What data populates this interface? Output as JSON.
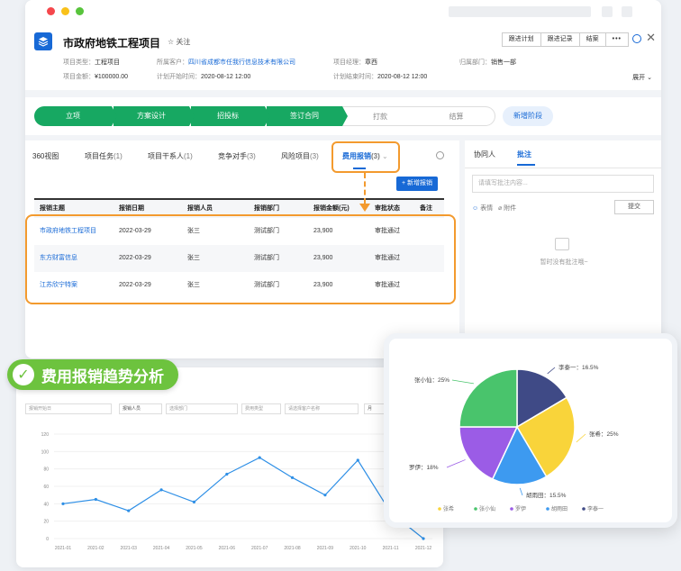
{
  "header": {
    "title": "市政府地铁工程项目",
    "follow": "关注",
    "actions": [
      "跟进计划",
      "跟进记录",
      "结案",
      "•••"
    ],
    "meta": [
      {
        "label": "项目类型：",
        "value": "工程项目"
      },
      {
        "label": "所属客户：",
        "value": "四川省成都市任我行信息技术有限公司"
      },
      {
        "label": "项目经理：",
        "value": "章西"
      },
      {
        "label": "归属部门：",
        "value": "销售一部"
      },
      {
        "label": "项目金额：",
        "value": "¥100000.00"
      },
      {
        "label": "计划开始时间：",
        "value": "2020-08-12  12:00"
      },
      {
        "label": "计划结束时间：",
        "value": "2020-08-12  12:00"
      }
    ],
    "expand": "展开"
  },
  "pipeline": {
    "stages": [
      "立项",
      "方案设计",
      "招投标",
      "签订合同",
      "打款",
      "结算"
    ],
    "done_count": 4,
    "new_stage": "新增阶段"
  },
  "tabs": [
    {
      "label": "360视图",
      "count": ""
    },
    {
      "label": "项目任务",
      "count": "(1)"
    },
    {
      "label": "项目干系人",
      "count": "(1)"
    },
    {
      "label": "竞争对手",
      "count": "(3)"
    },
    {
      "label": "风险项目",
      "count": "(3)"
    },
    {
      "label": "费用报销",
      "count": "(3)"
    }
  ],
  "add_button": "新增报销",
  "table": {
    "headers": [
      "报销主题",
      "报销日期",
      "报销人员",
      "报销部门",
      "报销金额(元)",
      "审批状态",
      "备注"
    ],
    "rows": [
      [
        "市政府地铁工程项目",
        "2022-03-29",
        "张三",
        "测试部门",
        "23,900",
        "审批通过",
        ""
      ],
      [
        "东方财富信息",
        "2022-03-29",
        "张三",
        "测试部门",
        "23,900",
        "审批通过",
        ""
      ],
      [
        "江苏欣宁特案",
        "2022-03-29",
        "张三",
        "测试部门",
        "23,900",
        "审批通过",
        ""
      ]
    ]
  },
  "side": {
    "tabs": [
      "协同人",
      "批注"
    ],
    "placeholder": "请填写批注内容...",
    "emoji": "表情",
    "attach": "附件",
    "submit": "提交",
    "empty": "暂时没有批注哦~"
  },
  "badge": "费用报销趋势分析",
  "filters": [
    "报销开始日",
    "报销人员",
    "选择部门",
    "费用类型",
    "请选择客户名称",
    "月"
  ],
  "chart_data": [
    {
      "type": "line",
      "x": [
        "2021-01",
        "2021-02",
        "2021-03",
        "2021-04",
        "2021-05",
        "2021-06",
        "2021-07",
        "2021-08",
        "2021-09",
        "2021-10",
        "2021-11",
        "2021-12"
      ],
      "series": [
        {
          "values": [
            40,
            45,
            32,
            56,
            42,
            74,
            93,
            70,
            50,
            90,
            30,
            0
          ]
        }
      ],
      "yticks": [
        "0",
        "20",
        "40",
        "60",
        "80",
        "100",
        "120"
      ],
      "ylim": [
        0,
        120
      ],
      "grid": true,
      "color": "#2e8fe6"
    },
    {
      "type": "pie",
      "slices": [
        {
          "name": "张希",
          "label": "张希：25%",
          "value": 25,
          "color": "#f9d43a"
        },
        {
          "name": "张小仙",
          "label": "张小仙：25%",
          "value": 25,
          "color": "#49c46c"
        },
        {
          "name": "罗伊",
          "label": "罗伊：18%",
          "value": 18,
          "color": "#9b5ce6"
        },
        {
          "name": "胡雨田",
          "label": "胡雨田：15.5%",
          "value": 15.5,
          "color": "#3d9af0"
        },
        {
          "name": "李泰一",
          "label": "李泰一：16.5%",
          "value": 16.5,
          "color": "#3f4a86"
        }
      ],
      "legend": [
        "张希",
        "张小仙",
        "罗伊",
        "胡雨田",
        "李泰一"
      ],
      "legend_position": "bottom"
    }
  ]
}
